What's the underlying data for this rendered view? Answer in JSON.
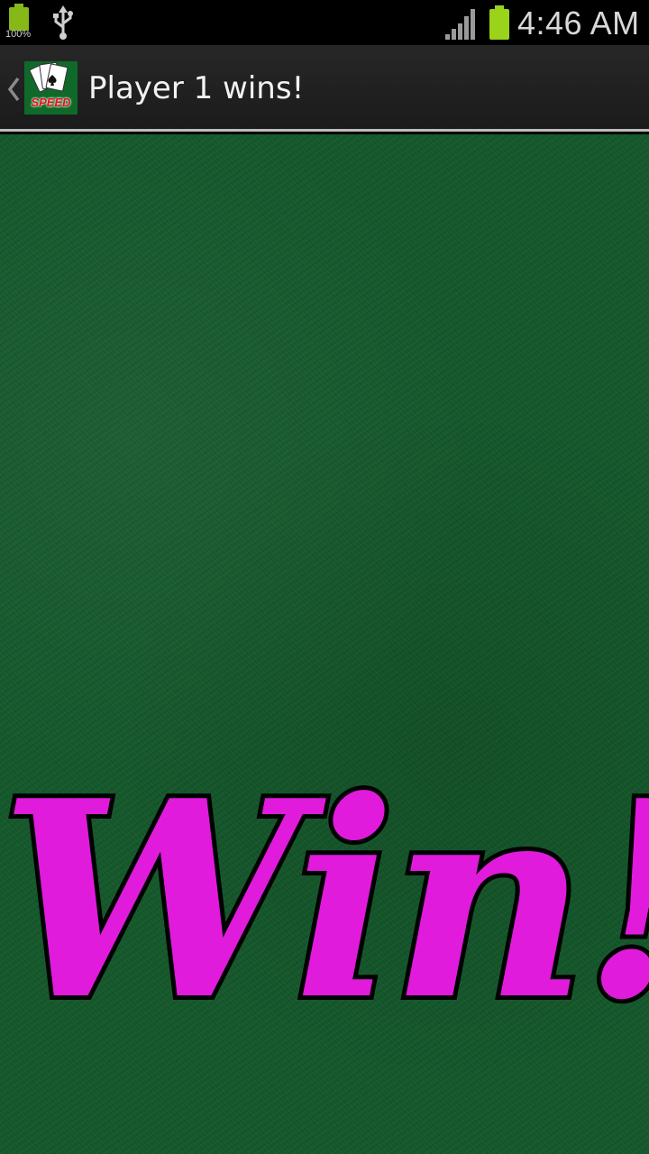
{
  "status_bar": {
    "small_battery_percent": "100%",
    "time": "4:46 AM",
    "icons": [
      "battery-small-icon",
      "usb-icon",
      "signal-icon",
      "battery-icon"
    ]
  },
  "action_bar": {
    "title": "Player 1 wins!",
    "app_icon_label": "SPEED",
    "up_icon": "chevron-left-icon"
  },
  "game": {
    "win_text": "Win!",
    "colors": {
      "felt": "#14582b",
      "win_fill": "#e11bdc",
      "win_outline": "#000000"
    }
  }
}
